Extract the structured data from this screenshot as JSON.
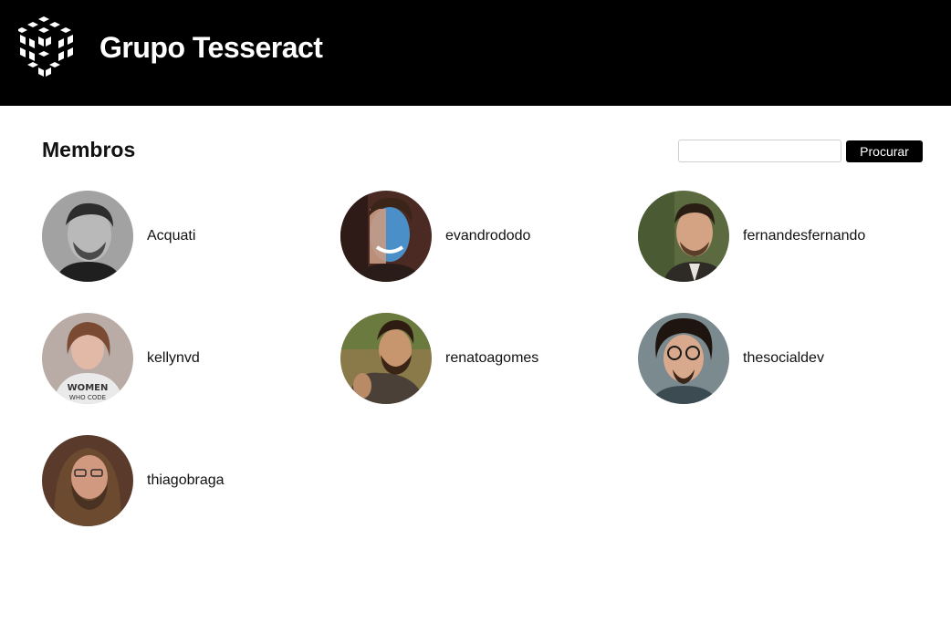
{
  "header": {
    "brand": "Grupo Tesseract"
  },
  "main": {
    "title": "Membros",
    "search": {
      "placeholder": "",
      "value": "",
      "button_label": "Procurar"
    },
    "members": [
      {
        "name": "Acquati"
      },
      {
        "name": "evandrododo"
      },
      {
        "name": "fernandesfernando"
      },
      {
        "name": "kellynvd"
      },
      {
        "name": "renatoagomes"
      },
      {
        "name": "thesocialdev"
      },
      {
        "name": "thiagobraga"
      }
    ]
  }
}
